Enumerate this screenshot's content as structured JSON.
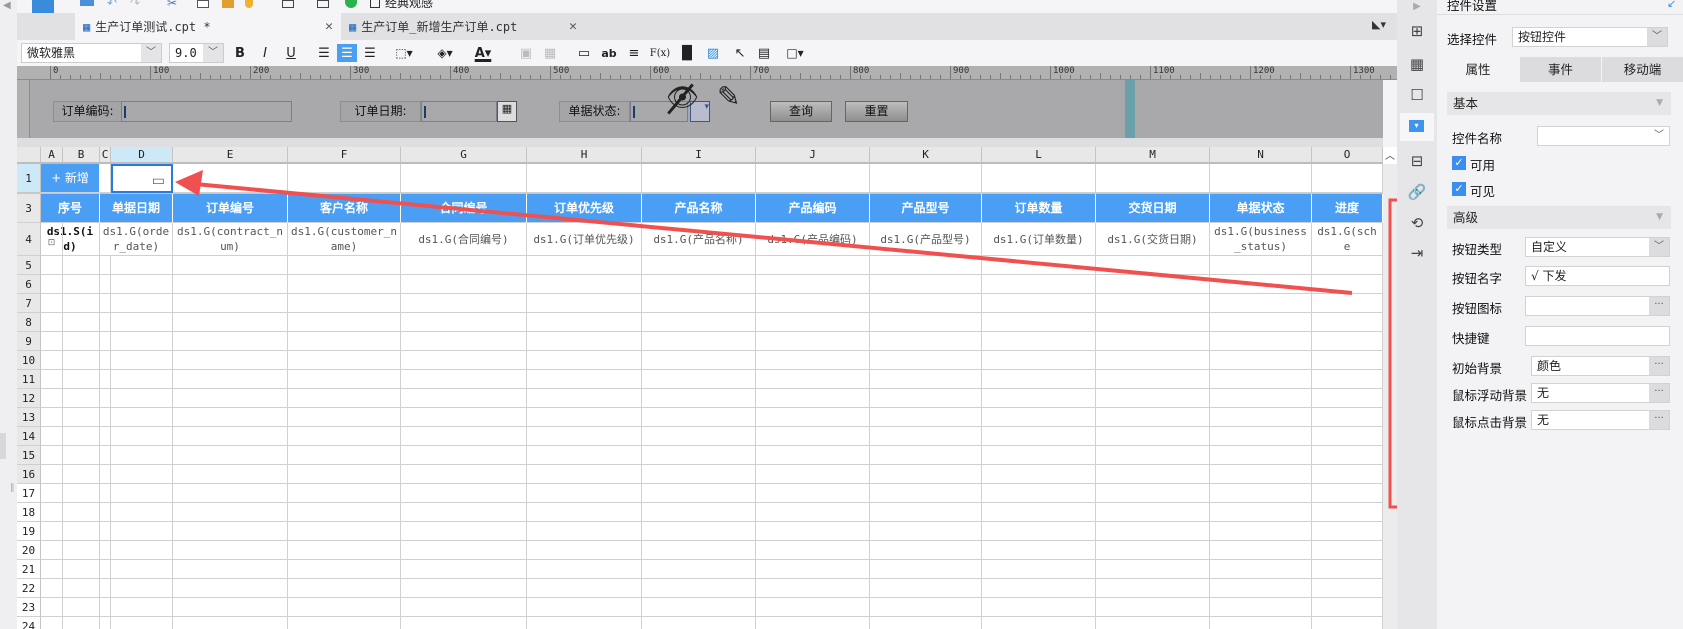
{
  "toolbar_top": {
    "classic_label": "经典观感"
  },
  "tabs": [
    {
      "label": "生产订单测试.cpt *",
      "active": true
    },
    {
      "label": "生产订单_新增生产订单.cpt",
      "active": false
    }
  ],
  "format": {
    "font": "微软雅黑",
    "size": "9.0",
    "bold": "B",
    "italic": "I",
    "underline": "U",
    "ab": "ab",
    "fx": "F(x)"
  },
  "ruler": {
    "labels": [
      "0",
      "100",
      "200",
      "300",
      "400",
      "500",
      "600",
      "700",
      "800",
      "900",
      "1000",
      "1100",
      "1200",
      "1300"
    ]
  },
  "params": {
    "order_no_label": "订单编码:",
    "order_date_label": "订单日期:",
    "status_label": "单据状态:",
    "query_button": "查询",
    "reset_button": "重置"
  },
  "grid": {
    "columns": [
      "A",
      "B",
      "C",
      "D",
      "E",
      "F",
      "G",
      "H",
      "I",
      "J",
      "K",
      "L",
      "M",
      "N",
      "O"
    ],
    "add_button": "+ 新增",
    "headers": [
      "序号",
      "单据日期",
      "订单编号",
      "客户名称",
      "合同编号",
      "订单优先级",
      "产品名称",
      "产品编码",
      "产品型号",
      "订单数量",
      "交货日期",
      "单据状态",
      "进度"
    ],
    "row4": [
      "ds1.S(id)",
      "ds1.G(order_date)",
      "ds1.G(contract_num)",
      "ds1.G(customer_name)",
      "ds1.G(合同编号)",
      "ds1.G(订单优先级)",
      "ds1.G(产品名称)",
      "ds1.G(产品编码)",
      "ds1.G(产品型号)",
      "ds1.G(订单数量)",
      "ds1.G(交货日期)",
      "ds1.G(business_status)",
      "ds1.G(sche"
    ],
    "row_numbers": [
      "1",
      "3",
      "4",
      "5",
      "6",
      "7",
      "8",
      "9",
      "10",
      "11",
      "12",
      "13",
      "14",
      "15",
      "16",
      "17",
      "18",
      "19",
      "20",
      "21",
      "22",
      "23",
      "24"
    ],
    "header_color": "#4a9ff5",
    "selected_cell": "D1"
  },
  "panel": {
    "title": "控件设置",
    "select_label": "选择控件",
    "select_value": "按钮控件",
    "tabs": [
      "属性",
      "事件",
      "移动端"
    ],
    "basic": {
      "title": "基本",
      "name_label": "控件名称",
      "name_value": "",
      "enabled_label": "可用",
      "enabled": true,
      "visible_label": "可见",
      "visible": true
    },
    "advanced": {
      "title": "高级",
      "type_label": "按钮类型",
      "type_value": "自定义",
      "name_label": "按钮名字",
      "name_value": "√ 下发",
      "icon_label": "按钮图标",
      "icon_value": "",
      "hotkey_label": "快捷键",
      "hotkey_value": "",
      "init_bg_label": "初始背景",
      "init_bg_value": "颜色",
      "hover_bg_label": "鼠标浮动背景",
      "hover_bg_value": "无",
      "click_bg_label": "鼠标点击背景",
      "click_bg_value": "无",
      "more": "···"
    }
  },
  "annotation_color": "#f05050"
}
